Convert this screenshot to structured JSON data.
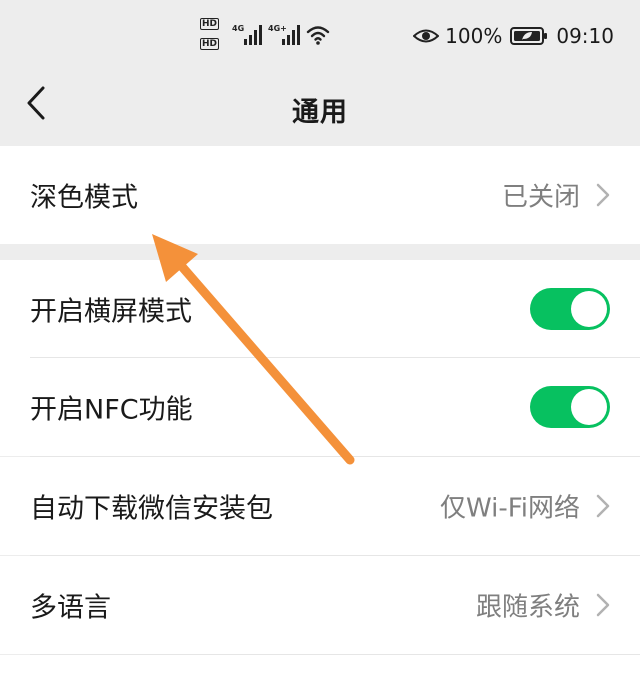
{
  "status_bar": {
    "hd_label_1": "HD",
    "hd_label_2": "HD",
    "network_1": "4G",
    "network_2": "4G+",
    "battery_percent": "100%",
    "time": "09:10"
  },
  "header": {
    "title": "通用"
  },
  "settings": {
    "dark_mode": {
      "label": "深色模式",
      "value": "已关闭"
    },
    "landscape": {
      "label": "开启横屏模式",
      "enabled": true
    },
    "nfc": {
      "label": "开启NFC功能",
      "enabled": true
    },
    "auto_download": {
      "label": "自动下载微信安装包",
      "value": "仅Wi-Fi网络"
    },
    "language": {
      "label": "多语言",
      "value": "跟随系统"
    }
  },
  "colors": {
    "toggle_on": "#07c160",
    "annotation_arrow": "#f4913a",
    "background": "#ededed"
  }
}
